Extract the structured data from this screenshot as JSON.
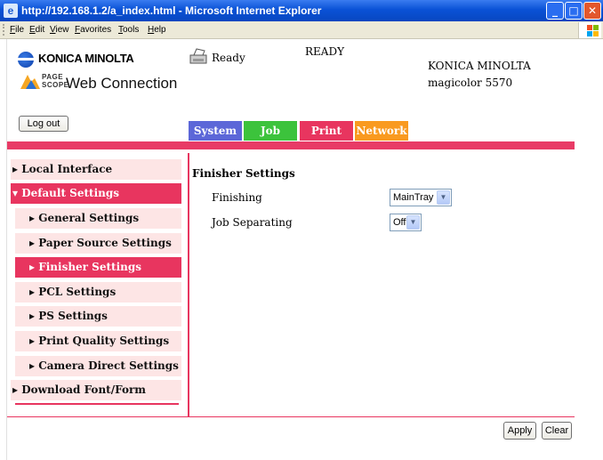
{
  "window": {
    "title": "http://192.168.1.2/a_index.html - Microsoft Internet Explorer",
    "minimize": "_",
    "maximize": "□",
    "close": "✕"
  },
  "menubar": {
    "items": [
      {
        "first": "F",
        "rest": "ile"
      },
      {
        "first": "E",
        "rest": "dit"
      },
      {
        "first": "V",
        "rest": "iew"
      },
      {
        "first": "F",
        "rest": "avorites",
        "prefix": "F",
        "label": "avorites"
      },
      {
        "first": "T",
        "rest": "ools"
      },
      {
        "first": "H",
        "rest": "elp"
      }
    ]
  },
  "header": {
    "brand": "KONICA MINOLTA",
    "pagescope_line1": "PAGE",
    "pagescope_line2": "SCOPE",
    "product": "Web Connection",
    "status_icon": "printer-icon",
    "status_label": "Ready",
    "status_message": "READY",
    "device_maker": "KONICA MINOLTA",
    "device_model": "magicolor 5570",
    "logout": "Log out"
  },
  "tabs": [
    {
      "label": "System",
      "color": "#5c67d8"
    },
    {
      "label": "Job",
      "color": "#3cc33c"
    },
    {
      "label": "Print",
      "color": "#e8355f"
    },
    {
      "label": "Network",
      "color": "#f99a20"
    }
  ],
  "sidebar": {
    "items": [
      {
        "label": "▸ Local Interface"
      },
      {
        "label": "▾ Default Settings"
      },
      {
        "label": "▸ General Settings"
      },
      {
        "label": "▸ Paper Source Settings"
      },
      {
        "label": "▸ Finisher Settings"
      },
      {
        "label": "▸ PCL Settings"
      },
      {
        "label": "▸ PS Settings"
      },
      {
        "label": "▸ Print Quality Settings"
      },
      {
        "label": "▸ Camera Direct Settings"
      },
      {
        "label": "▸ Download Font/Form"
      }
    ]
  },
  "main": {
    "section_title": "Finisher Settings",
    "fields": [
      {
        "label": "Finishing",
        "value": "MainTray"
      },
      {
        "label": "Job Separating",
        "value": "Off"
      }
    ],
    "apply": "Apply",
    "clear": "Clear"
  },
  "colors": {
    "accent": "#e8355f",
    "sidebar_bg": "#fde5e5"
  }
}
